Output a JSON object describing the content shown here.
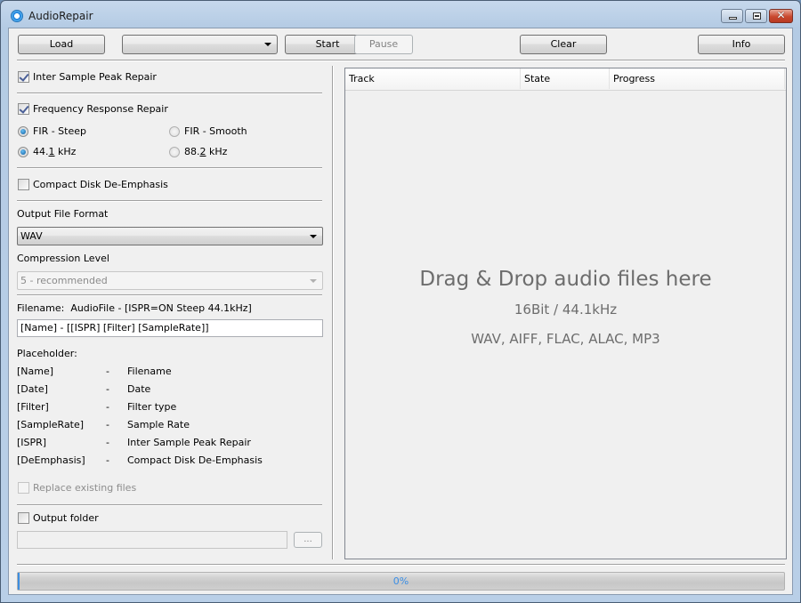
{
  "window": {
    "title": "AudioRepair",
    "controls": {
      "minimize": "minimize-icon",
      "maximize": "maximize-icon",
      "close": "close-icon"
    }
  },
  "toolbar": {
    "load_label": "Load",
    "preset_value": "",
    "start_label": "Start",
    "pause_label": "Pause",
    "clear_label": "Clear",
    "info_label": "Info"
  },
  "options": {
    "isp_repair": {
      "label": "Inter Sample Peak Repair",
      "checked": true
    },
    "freq_repair": {
      "label": "Frequency Response Repair",
      "checked": true
    },
    "filter": {
      "steep_label": "FIR - Steep",
      "smooth_label": "FIR - Smooth",
      "selected": "FIR - Steep"
    },
    "samplerate": {
      "r1_pre": "44.",
      "r1_u": "1",
      "r1_post": " kHz",
      "r2_pre": "88.",
      "r2_u": "2",
      "r2_post": " kHz",
      "selected": "44.1 kHz"
    },
    "deemphasis": {
      "label": "Compact Disk De-Emphasis",
      "checked": false
    },
    "output_format": {
      "label": "Output File Format",
      "value": "WAV"
    },
    "compression": {
      "label": "Compression Level",
      "value": "5 - recommended",
      "enabled": false
    },
    "filename": {
      "label": "Filename:",
      "preview": "AudioFile - [ISPR=ON Steep 44.1kHz]",
      "pattern": "[Name] - [[ISPR] [Filter] [SampleRate]]"
    },
    "placeholders": {
      "title": "Placeholder:",
      "separator": "-",
      "items": [
        {
          "key": "[Name]",
          "desc": "Filename"
        },
        {
          "key": "[Date]",
          "desc": "Date"
        },
        {
          "key": "[Filter]",
          "desc": "Filter type"
        },
        {
          "key": "[SampleRate]",
          "desc": "Sample Rate"
        },
        {
          "key": "[ISPR]",
          "desc": "Inter Sample Peak Repair"
        },
        {
          "key": "[DeEmphasis]",
          "desc": "Compact Disk De-Emphasis"
        }
      ]
    },
    "replace_existing": {
      "label": "Replace existing files",
      "checked": false,
      "enabled": false
    },
    "output_folder": {
      "label": "Output folder",
      "checked": false,
      "path": "",
      "browse_label": "..."
    }
  },
  "tracklist": {
    "columns": [
      "Track",
      "State",
      "Progress"
    ],
    "drop_title": "Drag & Drop audio files here",
    "drop_format": "16Bit / 44.1kHz",
    "drop_types": "WAV, AIFF, FLAC, ALAC, MP3"
  },
  "progress": {
    "value_percent": 0,
    "label": "0%"
  }
}
